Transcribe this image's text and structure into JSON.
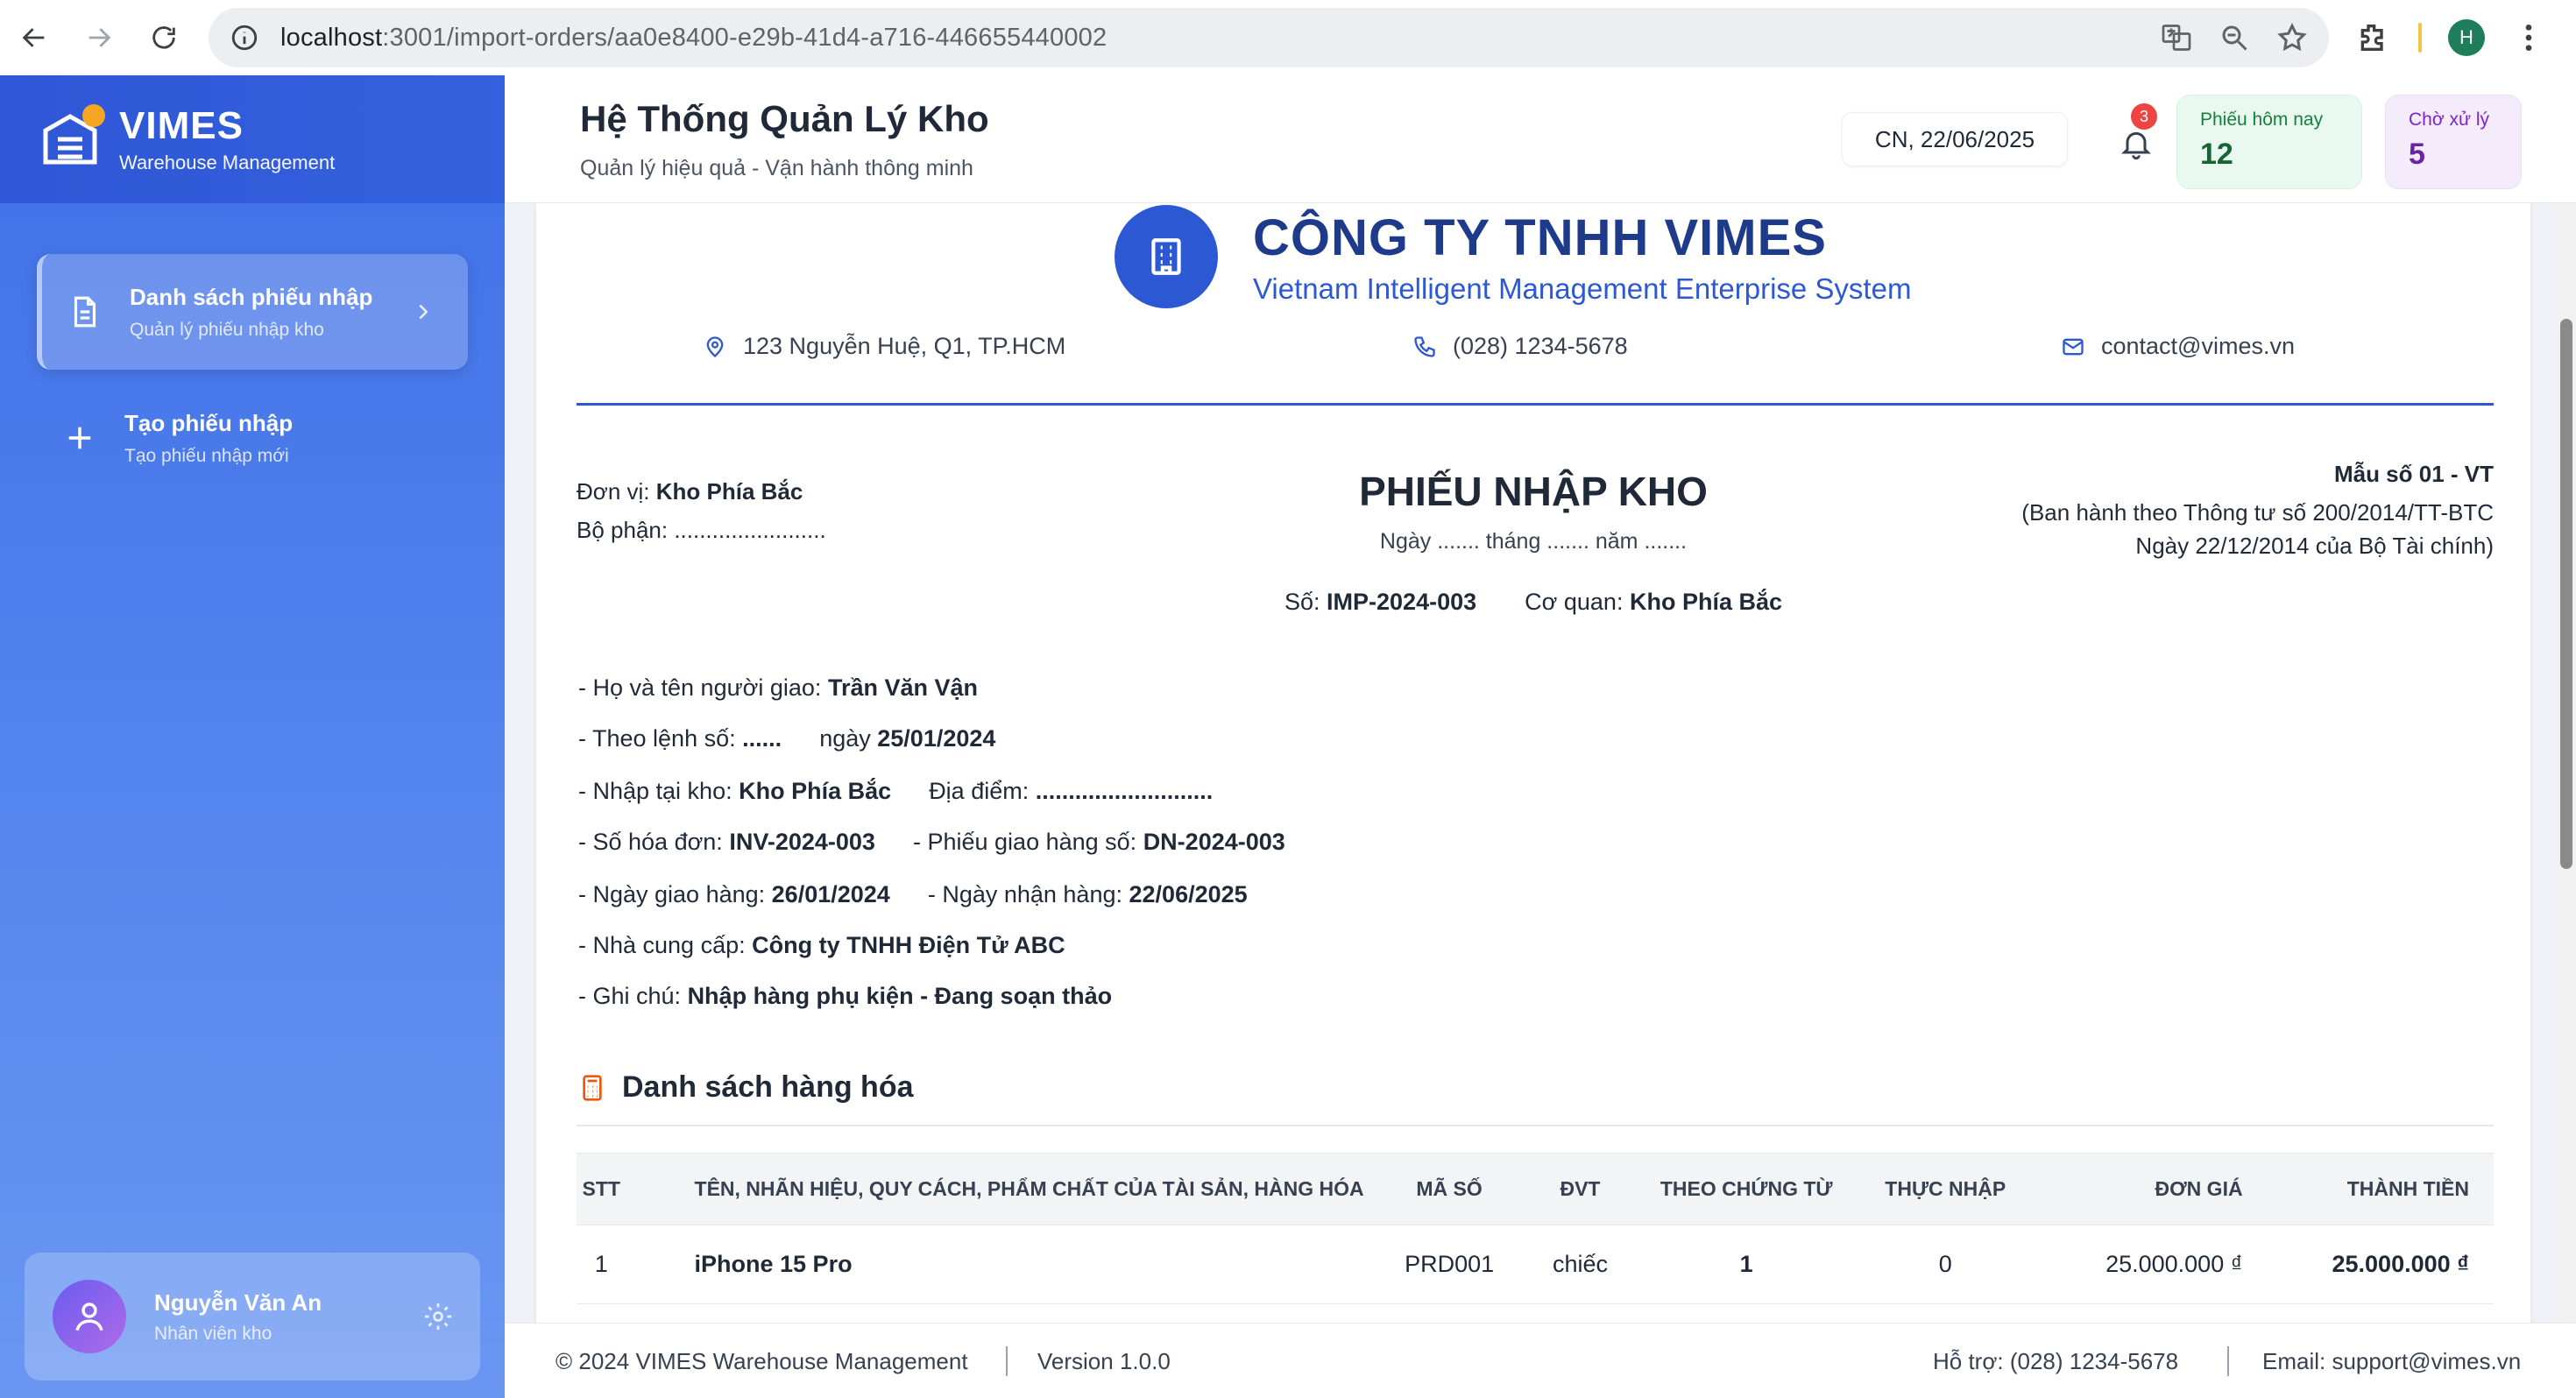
{
  "browser": {
    "url_host": "localhost",
    "url_path": ":3001/import-orders/aa0e8400-e29b-41d4-a716-446655440002",
    "profile_initial": "H"
  },
  "sidebar": {
    "brand_name": "VIMES",
    "brand_sub": "Warehouse Management",
    "items": [
      {
        "title": "Danh sách phiếu nhập",
        "subtitle": "Quản lý phiếu nhập kho"
      },
      {
        "title": "Tạo phiếu nhập",
        "subtitle": "Tạo phiếu nhập mới"
      }
    ],
    "user": {
      "name": "Nguyễn Văn An",
      "role": "Nhân viên kho"
    }
  },
  "header": {
    "title": "Hệ Thống Quản Lý Kho",
    "subtitle": "Quản lý hiệu quả - Vận hành thông minh",
    "date": "CN, 22/06/2025",
    "notification_count": "3",
    "stats": [
      {
        "label": "Phiếu hôm nay",
        "value": "12"
      },
      {
        "label": "Chờ xử lý",
        "value": "5"
      }
    ]
  },
  "document": {
    "company_name": "CÔNG TY TNHH VIMES",
    "company_full": "Vietnam Intelligent Management Enterprise System",
    "address": "123 Nguyễn Huệ, Q1, TP.HCM",
    "phone": "(028) 1234-5678",
    "email": "contact@vimes.vn",
    "unit_label": "Đơn vị:",
    "unit_value": "Kho Phía Bắc",
    "department": "Bộ phận: ........................",
    "title": "PHIẾU NHẬP KHO",
    "date_line": "Ngày ....... tháng ....... năm .......",
    "form_code": "Mẫu số 01 - VT",
    "form_note_1": "(Ban hành theo Thông tư số 200/2014/TT-BTC",
    "form_note_2": "Ngày 22/12/2014 của Bộ Tài chính)",
    "number_label": "Số:",
    "number_value": "IMP-2024-003",
    "agency_label": "Cơ quan:",
    "agency_value": "Kho Phía Bắc",
    "deliverer_label": "- Họ và tên người giao:",
    "deliverer_value": "Trần Văn Vận",
    "order_label": "- Theo lệnh số:",
    "order_value": "......",
    "order_date_label": "ngày",
    "order_date_value": "25/01/2024",
    "warehouse_label": "- Nhập tại kho:",
    "warehouse_value": "Kho Phía Bắc",
    "location_label": "Địa điểm:",
    "location_value": "...........................",
    "invoice_label": "- Số hóa đơn:",
    "invoice_value": "INV-2024-003",
    "delivery_note_label": "- Phiếu giao hàng số:",
    "delivery_note_value": "DN-2024-003",
    "delivery_date_label": "- Ngày giao hàng:",
    "delivery_date_value": "26/01/2024",
    "receive_date_label": "- Ngày nhận hàng:",
    "receive_date_value": "22/06/2025",
    "supplier_label": "- Nhà cung cấp:",
    "supplier_value": "Công ty TNHH Điện Tử ABC",
    "note_label": "- Ghi chú:",
    "note_value": "Nhập hàng phụ kiện - Đang soạn thảo",
    "section_title": "Danh sách hàng hóa",
    "table_headers": [
      "STT",
      "TÊN, NHÃN HIỆU, QUY CÁCH, PHẨM CHẤT CỦA TÀI SẢN, HÀNG HÓA",
      "MÃ SỐ",
      "ĐVT",
      "THEO CHỨNG TỪ",
      "THỰC NHẬP",
      "ĐƠN GIÁ",
      "THÀNH TIỀN"
    ],
    "rows": [
      [
        "1",
        "iPhone 15 Pro",
        "PRD001",
        "chiếc",
        "1",
        "0",
        "25.000.000 ₫",
        "25.000.000 ₫"
      ]
    ]
  },
  "footer": {
    "copyright": "© 2024 VIMES Warehouse Management",
    "version": "Version 1.0.0",
    "support": "Hỗ trợ: (028) 1234-5678",
    "email": "Email: support@vimes.vn"
  }
}
